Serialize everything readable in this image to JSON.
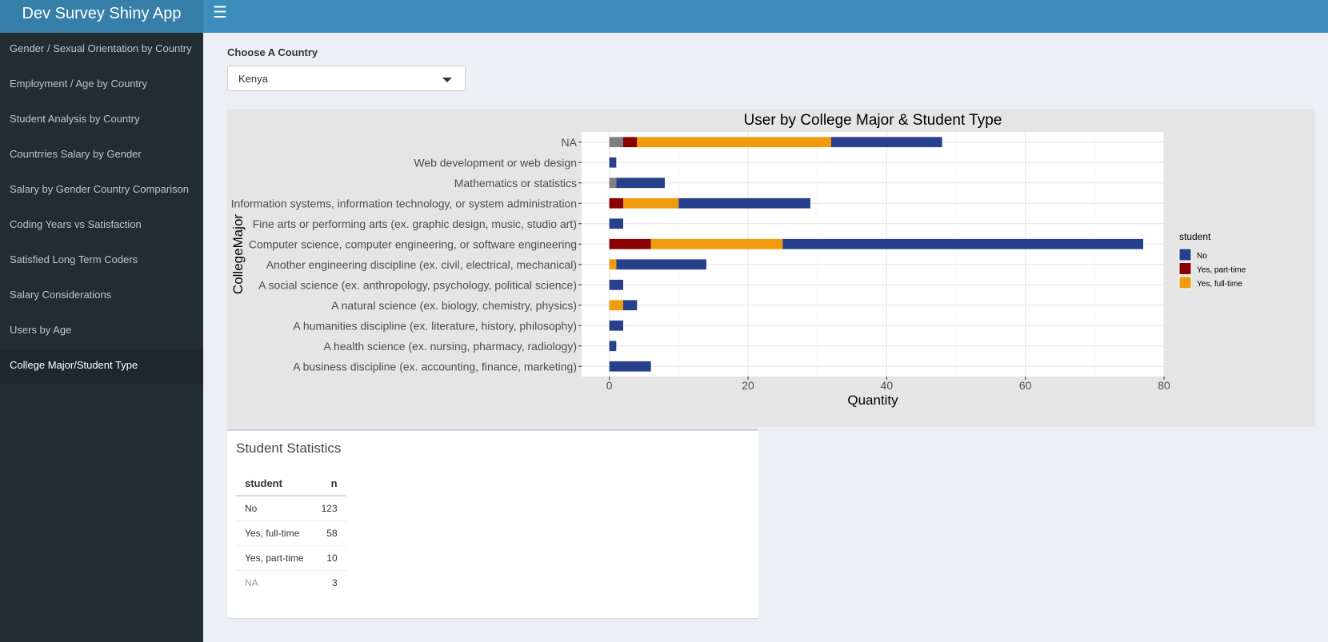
{
  "app": {
    "title": "Dev Survey Shiny App"
  },
  "sidebar": {
    "items": [
      {
        "label": "Gender / Sexual Orientation by Country"
      },
      {
        "label": "Employment / Age by Country"
      },
      {
        "label": "Student Analysis by Country"
      },
      {
        "label": "Countrries Salary by Gender"
      },
      {
        "label": "Salary by Gender Country Comparison"
      },
      {
        "label": "Coding Years vs Satisfaction"
      },
      {
        "label": "Satisfied Long Term Coders"
      },
      {
        "label": "Salary Considerations"
      },
      {
        "label": "Users by Age"
      },
      {
        "label": "College Major/Student Type"
      }
    ]
  },
  "country_select": {
    "label": "Choose A Country",
    "value": "Kenya"
  },
  "chart_data": {
    "type": "bar",
    "orientation": "horizontal",
    "stacked": true,
    "title": "User by College Major & Student Type",
    "xlabel": "Quantity",
    "ylabel": "CollegeMajor",
    "xlim": [
      -4,
      80
    ],
    "xticks": [
      0,
      20,
      40,
      60,
      80
    ],
    "categories": [
      "NA",
      "Web development or web design",
      "Mathematics or statistics",
      "Information systems, information technology, or system administration",
      "Fine arts or performing arts (ex. graphic design, music, studio art)",
      "Computer science, computer engineering, or software engineering",
      "Another engineering discipline (ex. civil, electrical, mechanical)",
      "A social science (ex. anthropology, psychology, political science)",
      "A natural science (ex. biology, chemistry, physics)",
      "A humanities discipline (ex. literature, history, philosophy)",
      "A health science (ex. nursing, pharmacy, radiology)",
      "A business discipline (ex. accounting, finance, marketing)"
    ],
    "series": [
      {
        "name": "",
        "color": "#7f7f7f",
        "values": [
          2,
          0,
          1,
          0,
          0,
          0,
          0,
          0,
          0,
          0,
          0,
          0
        ]
      },
      {
        "name": "Yes, part-time",
        "color": "#8b0000",
        "values": [
          2,
          0,
          0,
          2,
          0,
          6,
          0,
          0,
          0,
          0,
          0,
          0
        ]
      },
      {
        "name": "Yes, full-time",
        "color": "#f09b0c",
        "values": [
          28,
          0,
          0,
          8,
          0,
          19,
          1,
          0,
          2,
          0,
          0,
          0
        ]
      },
      {
        "name": "No",
        "color": "#27408b",
        "values": [
          16,
          1,
          7,
          19,
          2,
          52,
          13,
          2,
          2,
          2,
          1,
          6
        ]
      }
    ],
    "legend": {
      "title": "student",
      "position": "right",
      "entries": [
        {
          "label": "No",
          "color": "#27408b"
        },
        {
          "label": "Yes, part-time",
          "color": "#8b0000"
        },
        {
          "label": "Yes, full-time",
          "color": "#f09b0c"
        }
      ]
    },
    "grid": true
  },
  "stats": {
    "title": "Student Statistics",
    "headers": [
      "student",
      "n"
    ],
    "rows": [
      {
        "student": "No",
        "n": "123"
      },
      {
        "student": "Yes, full-time",
        "n": "58"
      },
      {
        "student": "Yes, part-time",
        "n": "10"
      },
      {
        "student": "NA",
        "n": "3"
      }
    ]
  }
}
